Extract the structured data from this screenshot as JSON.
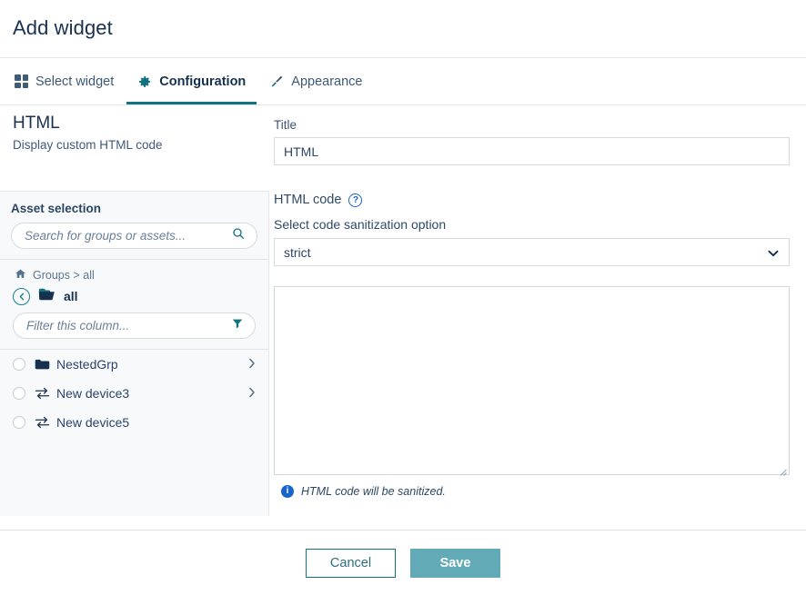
{
  "dialog": {
    "title": "Add widget"
  },
  "tabs": [
    {
      "label": "Select widget",
      "icon": "grid-icon",
      "active": false
    },
    {
      "label": "Configuration",
      "icon": "gear-icon",
      "active": true
    },
    {
      "label": "Appearance",
      "icon": "paintbrush-icon",
      "active": false
    }
  ],
  "widget": {
    "name": "HTML",
    "description": "Display custom HTML code"
  },
  "title_field": {
    "label": "Title",
    "value": "HTML"
  },
  "asset_selection": {
    "heading": "Asset selection",
    "search_placeholder": "Search for groups or assets...",
    "search_value": "",
    "search_icon": "search-icon",
    "breadcrumb": "Groups > all",
    "breadcrumb_home_icon": "home-icon",
    "back_icon": "chevron-left-icon",
    "current_group": "all",
    "current_group_icon": "folder-open-icon",
    "filter_placeholder": "Filter this column...",
    "filter_value": "",
    "filter_icon": "funnel-icon",
    "items": [
      {
        "label": "NestedGrp",
        "icon": "folder-icon",
        "has_chevron": true,
        "selected": false
      },
      {
        "label": "New device3",
        "icon": "device-exchange-icon",
        "has_chevron": true,
        "selected": false
      },
      {
        "label": "New device5",
        "icon": "device-exchange-icon",
        "has_chevron": false,
        "selected": false
      }
    ]
  },
  "code_section": {
    "title": "HTML code",
    "help_icon": "help-circle-icon",
    "help_glyph": "?",
    "sanitization_label": "Select code sanitization option",
    "sanitization_value": "strict",
    "sanitization_options": [
      "strict"
    ],
    "code_value": "",
    "hint_icon": "info-icon",
    "hint_glyph": "i",
    "hint_text": "HTML code will be sanitized."
  },
  "footer": {
    "cancel_label": "Cancel",
    "save_label": "Save"
  },
  "colors": {
    "accent_teal": "#11737f",
    "save_teal": "#63aab7",
    "navy": "#17314f",
    "info_blue": "#1765cc",
    "panel_bg": "#f7f9fb"
  }
}
